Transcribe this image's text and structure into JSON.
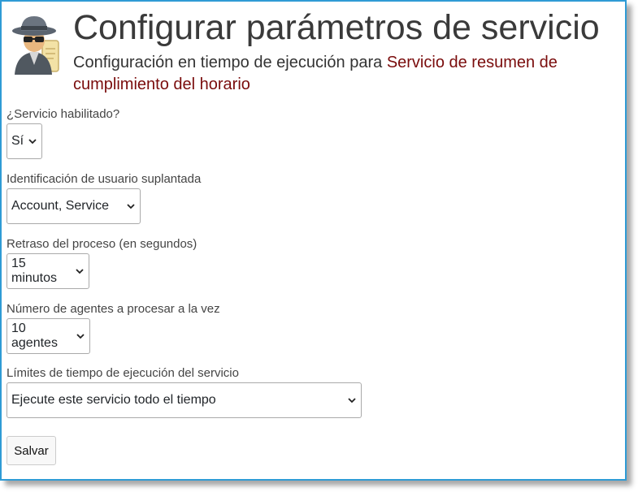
{
  "header": {
    "title": "Configurar parámetros de servicio",
    "subtitle_prefix": "Configuración en tiempo de ejecución para ",
    "service_name": "Servicio de resumen de cumplimiento del horario",
    "icon": "spy-icon"
  },
  "fields": [
    {
      "label": "¿Servicio habilitado?",
      "value": "Sí"
    },
    {
      "label": "Identificación de usuario suplantada",
      "value": "Account, Service"
    },
    {
      "label": "Retraso del proceso (en segundos)",
      "value": "15 minutos"
    },
    {
      "label": "Número de agentes a procesar a la vez",
      "value": "10 agentes"
    },
    {
      "label": "Límites de tiempo de ejecución del servicio",
      "value": "Ejecute este servicio todo el tiempo"
    }
  ],
  "actions": {
    "save_label": "Salvar"
  },
  "colors": {
    "border": "#2f9bd5",
    "service_name": "#7a0c0c"
  }
}
